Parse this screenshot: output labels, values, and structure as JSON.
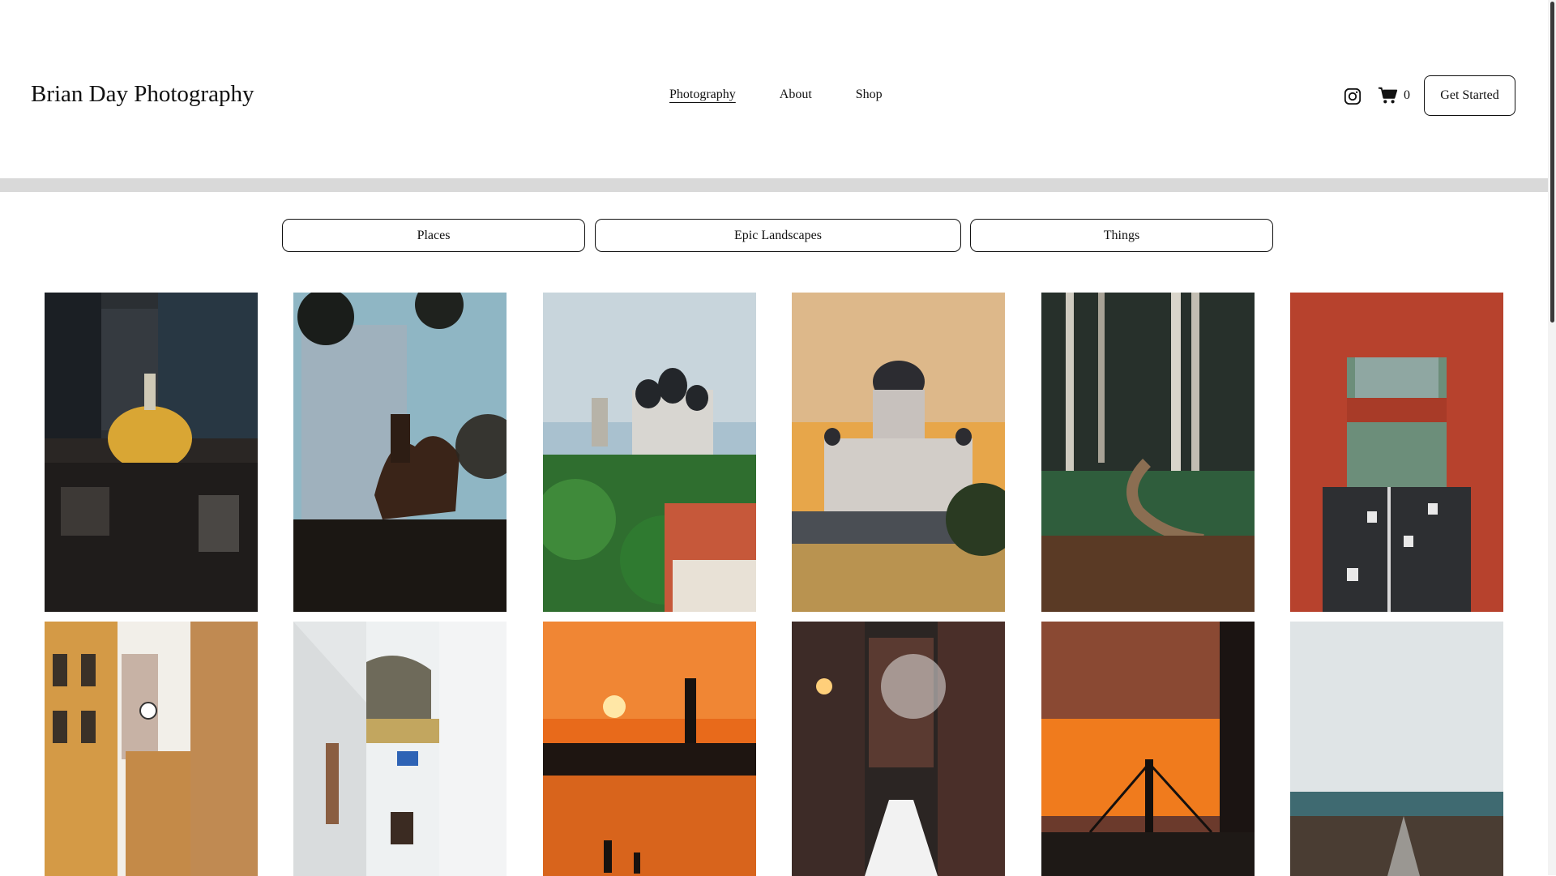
{
  "site": {
    "title": "Brian Day Photography"
  },
  "nav": {
    "items": [
      {
        "label": "Photography",
        "active": true
      },
      {
        "label": "About",
        "active": false
      },
      {
        "label": "Shop",
        "active": false
      }
    ]
  },
  "header_actions": {
    "instagram_icon": "instagram-icon",
    "cart_icon": "cart-icon",
    "cart_count": "0",
    "cta_label": "Get Started"
  },
  "filters": [
    {
      "label": "Places"
    },
    {
      "label": "Epic Landscapes"
    },
    {
      "label": "Things"
    }
  ],
  "gallery": {
    "photos": [
      {
        "subject": "golden-dome-city"
      },
      {
        "subject": "equestrian-statue"
      },
      {
        "subject": "cathedral-old-town"
      },
      {
        "subject": "cathedral-sunset"
      },
      {
        "subject": "forest-boardwalk"
      },
      {
        "subject": "red-bridge-traffic"
      },
      {
        "subject": "clock-tower-alley"
      },
      {
        "subject": "white-alley-flag"
      },
      {
        "subject": "sunset-obelisk-beach"
      },
      {
        "subject": "snowy-brick-alley"
      },
      {
        "subject": "bridge-sunset-road"
      },
      {
        "subject": "stormy-coast-road"
      }
    ]
  },
  "colors": {
    "text": "#111111",
    "divider": "#d9d9d9",
    "background": "#ffffff"
  }
}
